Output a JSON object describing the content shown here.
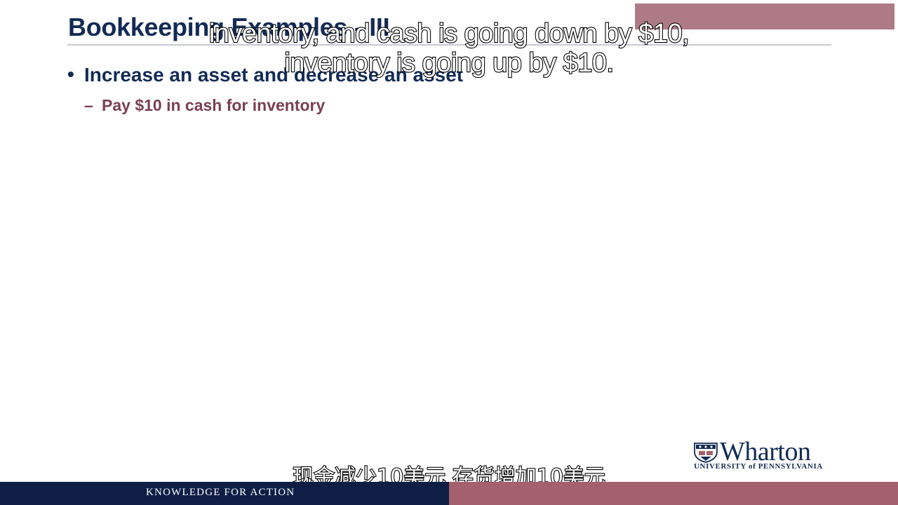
{
  "slide": {
    "title": "Bookkeeping Examples - III",
    "bullet": "Increase an asset and decrease an asset",
    "sub_bullet": "Pay $10 in cash for inventory"
  },
  "captions": {
    "en_line_1": "inventory, and cash is going down by $10,",
    "en_line_2": "inventory is going up by $10.",
    "zh": "现金减少10美元 存货增加10美元"
  },
  "logo": {
    "wordmark": "Wharton",
    "subtitle": "UNIVERSITY of PENNSYLVANIA"
  },
  "footer": {
    "tagline": "KNOWLEDGE FOR ACTION"
  },
  "colors": {
    "navy": "#132b55",
    "maroon": "#7a3f52",
    "footer_navy": "#0f1e45",
    "footer_rose": "#a5606d",
    "corner_block": "#ad7a86"
  }
}
